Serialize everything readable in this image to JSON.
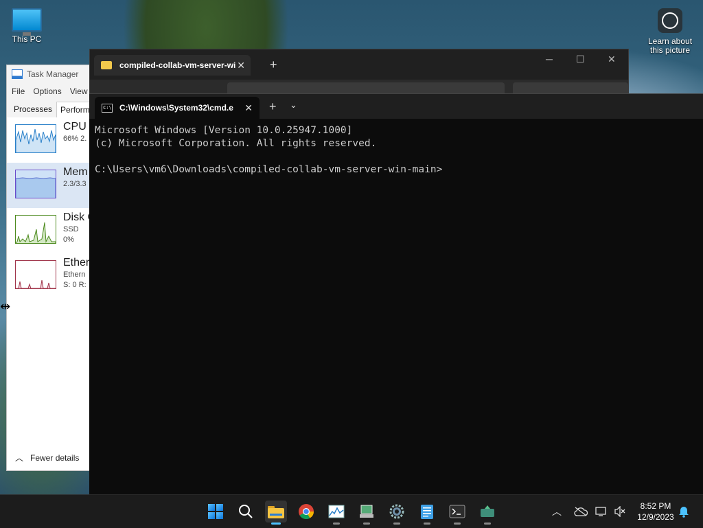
{
  "desktop": {
    "this_pc_label": "This PC",
    "learn_label_1": "Learn about",
    "learn_label_2": "this picture"
  },
  "task_manager": {
    "title": "Task Manager",
    "menu": [
      "File",
      "Options",
      "View"
    ],
    "tabs": [
      "Processes",
      "Performa"
    ],
    "items": [
      {
        "name": "CPU",
        "line2": "66%  2."
      },
      {
        "name": "Mem",
        "line2": "2.3/3.3"
      },
      {
        "name": "Disk C",
        "line2": "SSD",
        "line3": "0%"
      },
      {
        "name": "Ether",
        "line2": "Ethern",
        "line3": "S: 0  R:"
      }
    ],
    "fewer_details": "Fewer details"
  },
  "explorer": {
    "tab_title": "compiled-collab-vm-server-wi"
  },
  "terminal": {
    "tab_title": "C:\\Windows\\System32\\cmd.e",
    "lines": [
      "Microsoft Windows [Version 10.0.25947.1000]",
      "(c) Microsoft Corporation. All rights reserved.",
      "",
      "C:\\Users\\vm6\\Downloads\\compiled-collab-vm-server-win-main>"
    ]
  },
  "taskbar": {
    "apps": [
      "start-icon",
      "search-icon",
      "file-explorer-icon",
      "chrome-icon",
      "task-manager-icon",
      "device-manager-icon",
      "settings-icon",
      "notepad-icon",
      "terminal-icon",
      "app-icon"
    ],
    "active_app": "file-explorer-icon",
    "time": "8:52 PM",
    "date": "12/9/2023"
  }
}
